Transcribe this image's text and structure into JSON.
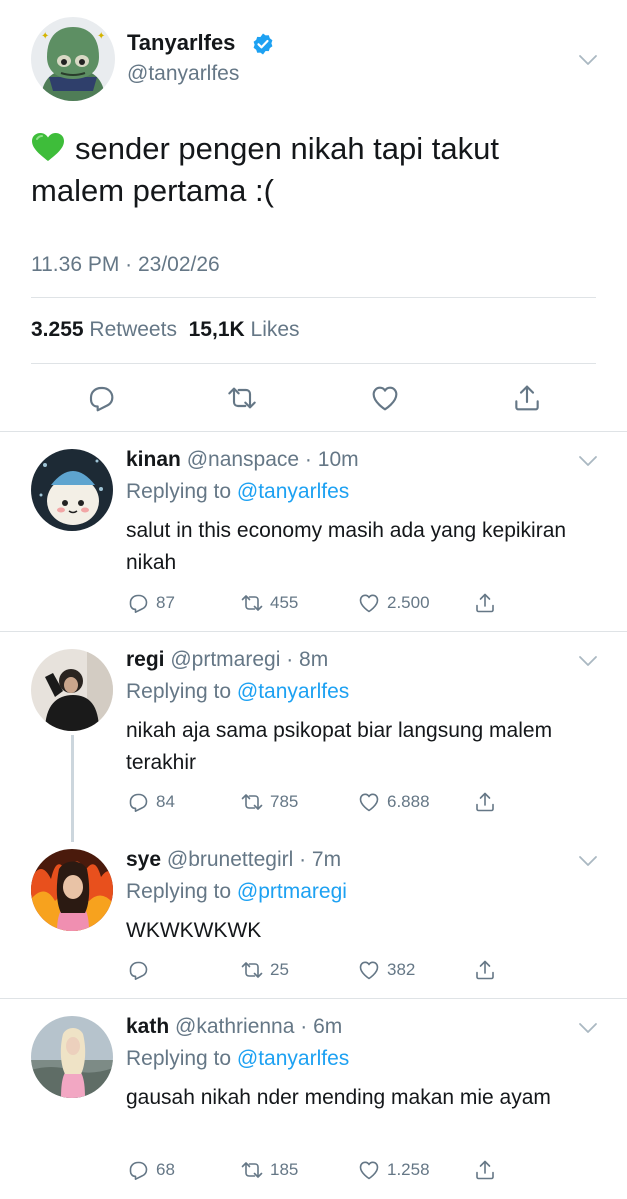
{
  "main_tweet": {
    "display_name": "Tanyarlfes",
    "handle": "@tanyarlfes",
    "text": "sender pengen nikah tapi takut malem pertama :(",
    "timestamp": "11.36 PM · 23/02/26",
    "retweets_count": "3.255",
    "retweets_label": "Retweets",
    "likes_count": "15,1K",
    "likes_label": "Likes",
    "verified_color": "#1da1f2",
    "emoji": "green-heart"
  },
  "replies": [
    {
      "name": "kinan",
      "handle_time": "@nanspace · 10m",
      "replying_prefix": "Replying to",
      "replying_to": "@tanyarlfes",
      "text": "salut in this economy masih ada yang kepikiran nikah",
      "replies": "87",
      "retweets": "455",
      "likes": "2.500"
    },
    {
      "name": "regi",
      "handle_time": "@prtmaregi · 8m",
      "replying_prefix": "Replying to",
      "replying_to": "@tanyarlfes",
      "text": "nikah aja sama psikopat biar langsung malem terakhir",
      "replies": "84",
      "retweets": "785",
      "likes": "6.888"
    },
    {
      "name": "sye",
      "handle_time": "@brunettegirl · 7m",
      "replying_prefix": "Replying to",
      "replying_to": "@prtmaregi",
      "text": "WKWKWKWK",
      "replies": "",
      "retweets": "25",
      "likes": "382"
    },
    {
      "name": "kath",
      "handle_time": "@kathrienna · 6m",
      "replying_prefix": "Replying to",
      "replying_to": "@tanyarlfes",
      "text": "gausah nikah nder mending makan mie ayam",
      "replies": "68",
      "retweets": "185",
      "likes": "1.258"
    }
  ],
  "colors": {
    "link": "#1da1f2",
    "secondary_text": "#657786",
    "primary_text": "#14171a",
    "divider": "#dfe3e6"
  }
}
